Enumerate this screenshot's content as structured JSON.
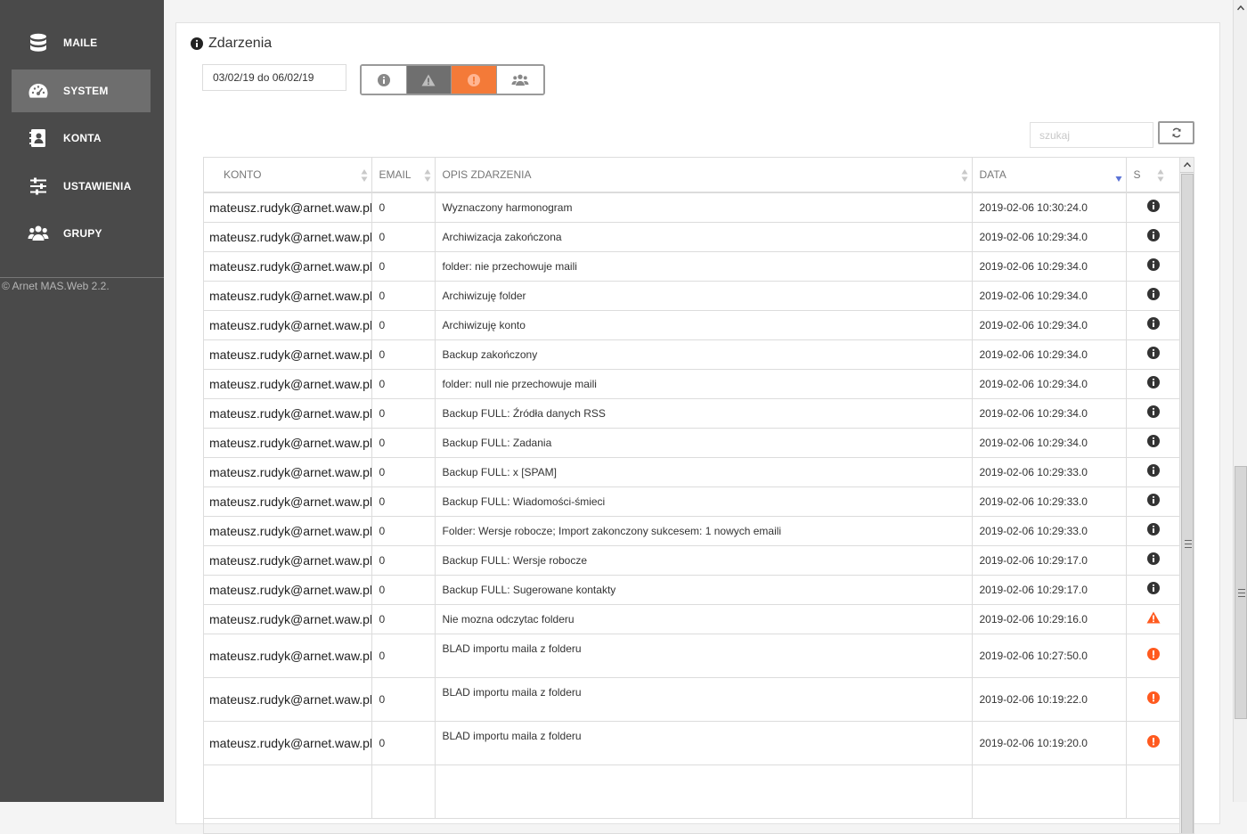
{
  "sidebar": {
    "items": [
      {
        "label": "MAILE",
        "icon": "database-icon"
      },
      {
        "label": "SYSTEM",
        "icon": "dashboard-icon",
        "active": true
      },
      {
        "label": "KONTA",
        "icon": "address-book-icon"
      },
      {
        "label": "USTAWIENIA",
        "icon": "sliders-icon"
      },
      {
        "label": "GRUPY",
        "icon": "users-icon"
      }
    ],
    "copyright": "©  Arnet MAS.Web 2.2."
  },
  "panel": {
    "title": "Zdarzenia",
    "date_range": "03/02/19 do 06/02/19",
    "filters": [
      {
        "icon": "info-icon",
        "state": "off"
      },
      {
        "icon": "warning-icon",
        "state": "on"
      },
      {
        "icon": "error-icon",
        "state": "on"
      },
      {
        "icon": "users-icon",
        "state": "off"
      }
    ],
    "search_placeholder": "szukaj"
  },
  "table": {
    "columns": [
      "KONTO",
      "EMAIL",
      "OPIS ZDARZENIA",
      "DATA",
      "S"
    ],
    "rows": [
      {
        "konto": "mateusz.rudyk@arnet.waw.pl",
        "email": "0",
        "opis": "Wyznaczony harmonogram",
        "data": "2019-02-06 10:30:24.0",
        "s": "info"
      },
      {
        "konto": "mateusz.rudyk@arnet.waw.pl",
        "email": "0",
        "opis": "Archiwizacja zakończona",
        "data": "2019-02-06 10:29:34.0",
        "s": "info"
      },
      {
        "konto": "mateusz.rudyk@arnet.waw.pl",
        "email": "0",
        "opis": "folder: nie przechowuje maili",
        "data": "2019-02-06 10:29:34.0",
        "s": "info"
      },
      {
        "konto": "mateusz.rudyk@arnet.waw.pl",
        "email": "0",
        "opis": "Archiwizuję folder",
        "data": "2019-02-06 10:29:34.0",
        "s": "info"
      },
      {
        "konto": "mateusz.rudyk@arnet.waw.pl",
        "email": "0",
        "opis": "Archiwizuję konto",
        "data": "2019-02-06 10:29:34.0",
        "s": "info"
      },
      {
        "konto": "mateusz.rudyk@arnet.waw.pl",
        "email": "0",
        "opis": "Backup zakończony",
        "data": "2019-02-06 10:29:34.0",
        "s": "info"
      },
      {
        "konto": "mateusz.rudyk@arnet.waw.pl",
        "email": "0",
        "opis": "folder: null nie przechowuje maili",
        "data": "2019-02-06 10:29:34.0",
        "s": "info"
      },
      {
        "konto": "mateusz.rudyk@arnet.waw.pl",
        "email": "0",
        "opis": "Backup FULL: Źródła danych RSS",
        "data": "2019-02-06 10:29:34.0",
        "s": "info"
      },
      {
        "konto": "mateusz.rudyk@arnet.waw.pl",
        "email": "0",
        "opis": "Backup FULL: Zadania",
        "data": "2019-02-06 10:29:34.0",
        "s": "info"
      },
      {
        "konto": "mateusz.rudyk@arnet.waw.pl",
        "email": "0",
        "opis": "Backup FULL: x [SPAM]",
        "data": "2019-02-06 10:29:33.0",
        "s": "info"
      },
      {
        "konto": "mateusz.rudyk@arnet.waw.pl",
        "email": "0",
        "opis": "Backup FULL: Wiadomości-śmieci",
        "data": "2019-02-06 10:29:33.0",
        "s": "info"
      },
      {
        "konto": "mateusz.rudyk@arnet.waw.pl",
        "email": "0",
        "opis": "Folder: Wersje robocze; Import zakonczony sukcesem: 1 nowych emaili",
        "data": "2019-02-06 10:29:33.0",
        "s": "info"
      },
      {
        "konto": "mateusz.rudyk@arnet.waw.pl",
        "email": "0",
        "opis": "Backup FULL: Wersje robocze",
        "data": "2019-02-06 10:29:17.0",
        "s": "info"
      },
      {
        "konto": "mateusz.rudyk@arnet.waw.pl",
        "email": "0",
        "opis": "Backup FULL: Sugerowane kontakty",
        "data": "2019-02-06 10:29:17.0",
        "s": "info"
      },
      {
        "konto": "mateusz.rudyk@arnet.waw.pl",
        "email": "0",
        "opis": "Nie mozna odczytac folderu",
        "data": "2019-02-06 10:29:16.0",
        "s": "warning"
      },
      {
        "konto": "mateusz.rudyk@arnet.waw.pl",
        "email": "0",
        "opis": "BLAD importu maila z folderu",
        "data": "2019-02-06 10:27:50.0",
        "s": "error"
      },
      {
        "konto": "mateusz.rudyk@arnet.waw.pl",
        "email": "0",
        "opis": "BLAD importu maila z folderu",
        "data": "2019-02-06 10:19:22.0",
        "s": "error"
      },
      {
        "konto": "mateusz.rudyk@arnet.waw.pl",
        "email": "0",
        "opis": "BLAD importu maila z folderu",
        "data": "2019-02-06 10:19:20.0",
        "s": "error"
      }
    ]
  },
  "colors": {
    "sidebar_bg": "#4a4a4a",
    "sidebar_active": "#6e6e6e",
    "accent_orange": "#f47a38",
    "warning": "#ff5a1f",
    "error": "#ff5a1f",
    "info": "#333333"
  }
}
